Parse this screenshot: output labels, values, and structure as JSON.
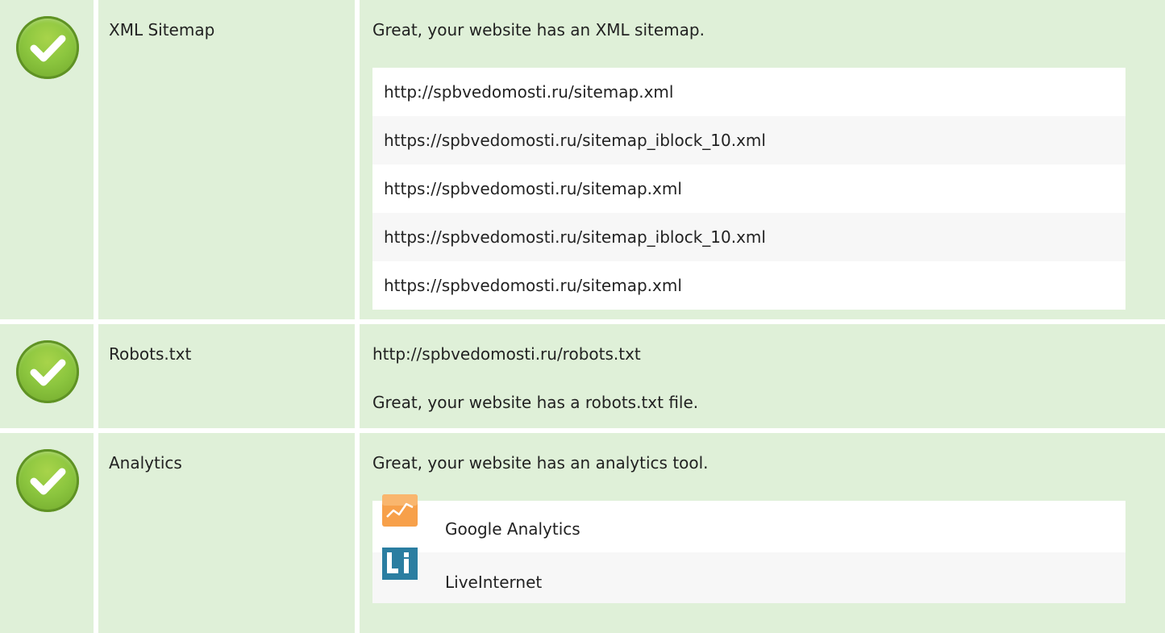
{
  "rows": [
    {
      "name": "XML Sitemap",
      "status_icon": "check-circle-icon",
      "message": "Great, your website has an XML sitemap.",
      "sitemaps": [
        "http://spbvedomosti.ru/sitemap.xml",
        "https://spbvedomosti.ru/sitemap_iblock_10.xml",
        "https://spbvedomosti.ru/sitemap.xml",
        "https://spbvedomosti.ru/sitemap_iblock_10.xml",
        "https://spbvedomosti.ru/sitemap.xml"
      ]
    },
    {
      "name": "Robots.txt",
      "status_icon": "check-circle-icon",
      "url": "http://spbvedomosti.ru/robots.txt",
      "message": "Great, your website has a robots.txt file."
    },
    {
      "name": "Analytics",
      "status_icon": "check-circle-icon",
      "message": "Great, your website has an analytics tool.",
      "tools": [
        {
          "label": "Google Analytics",
          "icon": "google-analytics-icon"
        },
        {
          "label": "LiveInternet",
          "icon": "liveinternet-icon"
        }
      ]
    }
  ],
  "colors": {
    "row_background": "#dff0d8",
    "check_green": "#8cc63f",
    "ga_orange": "#f7a04a",
    "li_blue": "#2b7ea1"
  }
}
